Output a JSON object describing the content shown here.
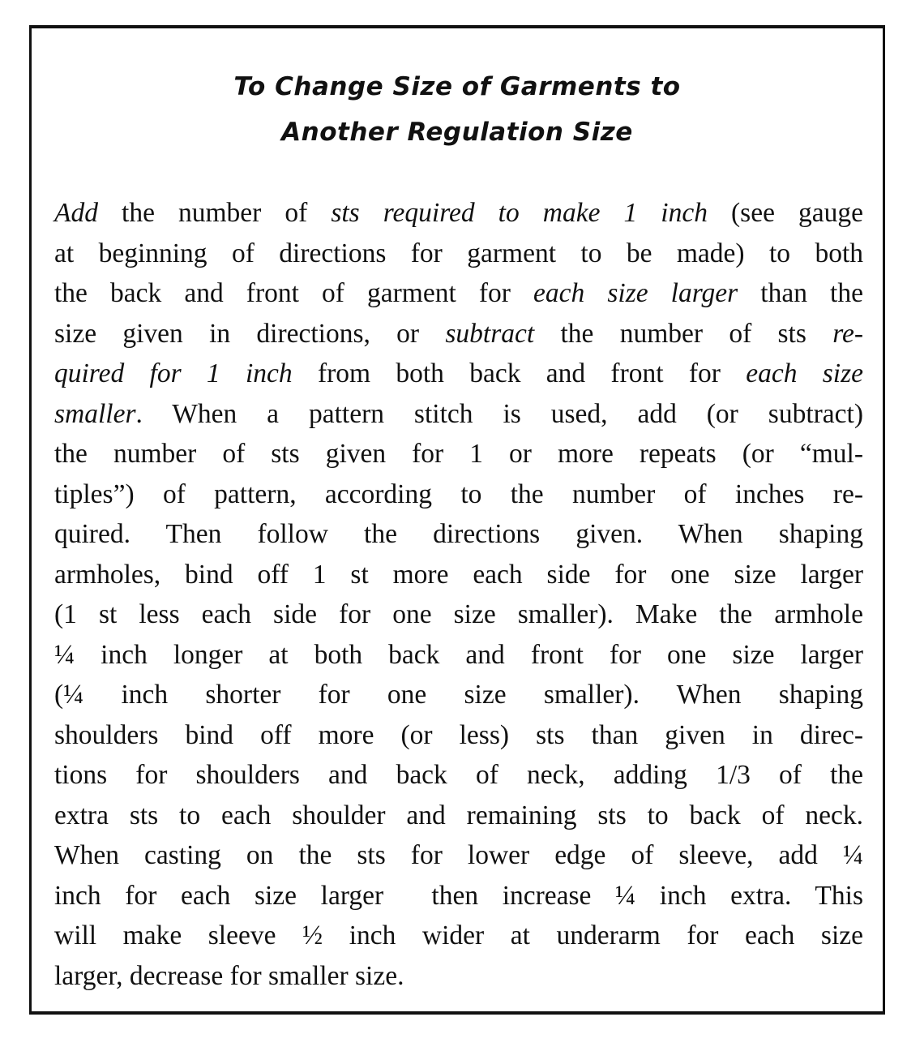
{
  "title": {
    "line1": "To Change Size of Garments to",
    "line2": "Another Regulation Size"
  },
  "body_lines": [
    [
      {
        "t": "Add",
        "i": true
      },
      {
        "t": " the number of "
      },
      {
        "t": "sts required to make 1 inch",
        "i": true
      },
      {
        "t": " (see gauge"
      }
    ],
    [
      {
        "t": "at beginning of directions for garment to be made) to both"
      }
    ],
    [
      {
        "t": "the back and front of garment for "
      },
      {
        "t": "each size larger",
        "i": true
      },
      {
        "t": " than the"
      }
    ],
    [
      {
        "t": "size given in directions, or "
      },
      {
        "t": "subtract",
        "i": true
      },
      {
        "t": " the number of sts "
      },
      {
        "t": "re-",
        "i": true
      }
    ],
    [
      {
        "t": "quired for 1 inch",
        "i": true
      },
      {
        "t": " from both back and front for "
      },
      {
        "t": "each size",
        "i": true
      }
    ],
    [
      {
        "t": "smaller",
        "i": true
      },
      {
        "t": ". When a pattern stitch is used, add (or subtract)"
      }
    ],
    [
      {
        "t": "the number of sts given for 1 or more repeats (or “mul-"
      }
    ],
    [
      {
        "t": "tiples”) of pattern, according to the number of inches re-"
      }
    ],
    [
      {
        "t": "quired. Then follow the directions given. When shaping"
      }
    ],
    [
      {
        "t": "armholes, bind off 1 st more each side for one size larger"
      }
    ],
    [
      {
        "t": "(1 st less each side for one size smaller). Make the armhole"
      }
    ],
    [
      {
        "t": "¼ inch longer at both back and front for one size larger"
      }
    ],
    [
      {
        "t": "(¼ inch shorter for one size smaller). When shaping"
      }
    ],
    [
      {
        "t": "shoulders bind off more (or less) sts than given in direc-"
      }
    ],
    [
      {
        "t": "tions for shoulders and back of neck, adding 1/3 of the"
      }
    ],
    [
      {
        "t": "extra sts to each shoulder and remaining sts to back of neck."
      }
    ],
    [
      {
        "t": "When casting on the sts for lower edge of sleeve, add ¼"
      }
    ],
    [
      {
        "t": "inch for each size larger  then increase ¼ inch extra. This"
      }
    ],
    [
      {
        "t": "will make sleeve ½ inch wider at underarm for each size"
      }
    ],
    [
      {
        "t": "larger, decrease for smaller size."
      }
    ]
  ]
}
